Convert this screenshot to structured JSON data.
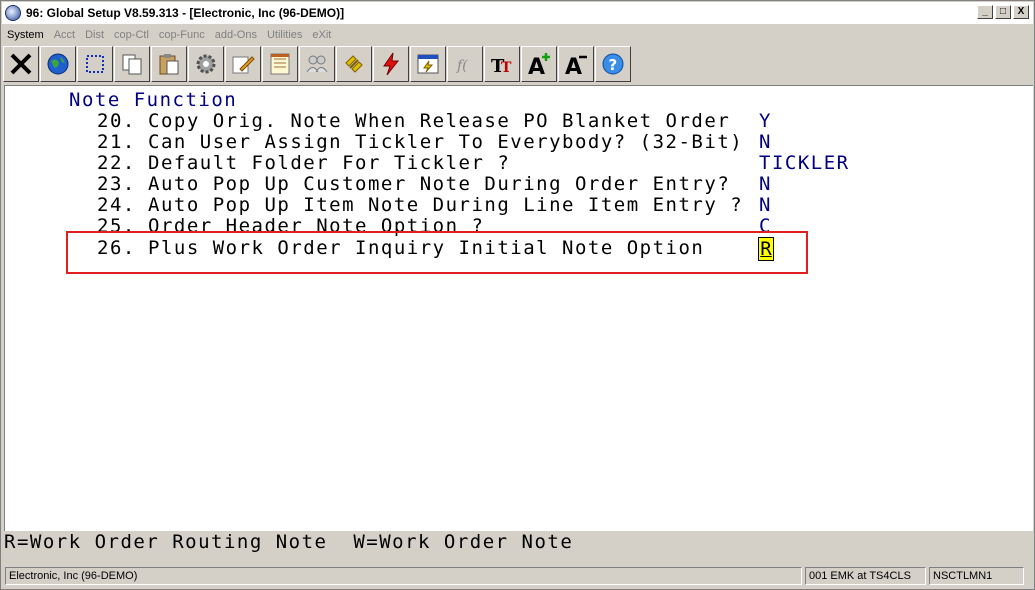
{
  "window": {
    "title": "96: Global Setup V8.59.313 - [Electronic, Inc (96-DEMO)]",
    "buttons": {
      "minimize": "_",
      "maximize": "□",
      "close": "X"
    }
  },
  "menu": [
    {
      "label": "System",
      "active": true
    },
    {
      "label": "Acct",
      "active": false
    },
    {
      "label": "Dist",
      "active": false
    },
    {
      "label": "cop-Ctl",
      "active": false
    },
    {
      "label": "cop-Func",
      "active": false
    },
    {
      "label": "add-Ons",
      "active": false
    },
    {
      "label": "Utilities",
      "active": false
    },
    {
      "label": "eXit",
      "active": false
    }
  ],
  "toolbar": [
    {
      "name": "close-icon"
    },
    {
      "name": "globe-icon"
    },
    {
      "name": "select-icon"
    },
    {
      "name": "copy-icon"
    },
    {
      "name": "paste-icon"
    },
    {
      "name": "gear-icon"
    },
    {
      "name": "edit-icon"
    },
    {
      "name": "notepad-icon"
    },
    {
      "name": "users-icon"
    },
    {
      "name": "link-icon"
    },
    {
      "name": "lightning-icon"
    },
    {
      "name": "window-icon"
    },
    {
      "name": "function-icon"
    },
    {
      "name": "font-icon"
    },
    {
      "name": "font-increase-icon"
    },
    {
      "name": "font-decrease-icon"
    },
    {
      "name": "help-icon"
    }
  ],
  "screen": {
    "section_title": "Note Function",
    "options": [
      {
        "num": "20.",
        "label": "Copy Orig. Note When Release PO Blanket Order",
        "value": "Y"
      },
      {
        "num": "21.",
        "label": "Can User Assign Tickler To Everybody? (32-Bit)",
        "value": "N"
      },
      {
        "num": "22.",
        "label": "Default Folder For Tickler ?",
        "value": "TICKLER"
      },
      {
        "num": "23.",
        "label": "Auto Pop Up Customer Note During Order Entry?",
        "value": "N"
      },
      {
        "num": "24.",
        "label": "Auto Pop Up Item Note During Line Item Entry ?",
        "value": "N"
      },
      {
        "num": "25.",
        "label": "Order Header Note Option ?",
        "value": "C"
      },
      {
        "num": "26.",
        "label": "Plus Work Order Inquiry Initial Note Option",
        "value": "R"
      }
    ]
  },
  "hint": "R=Work Order Routing Note  W=Work Order Note",
  "status": {
    "company": "Electronic, Inc (96-DEMO)",
    "session": "001 EMK at TS4CLS",
    "program": "NSCTLMN1"
  }
}
